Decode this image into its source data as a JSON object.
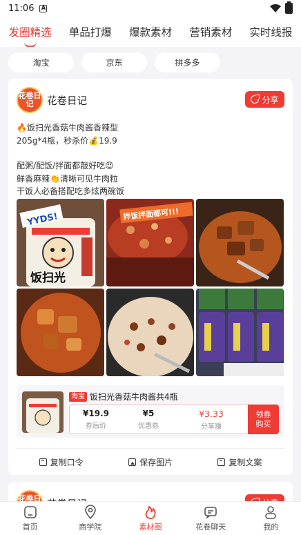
{
  "status_bar": {
    "time": "11:06",
    "sim_label": "A"
  },
  "top_tabs": [
    {
      "label": "发圈精选",
      "active": true
    },
    {
      "label": "单品打爆",
      "active": false
    },
    {
      "label": "爆款素材",
      "active": false
    },
    {
      "label": "营销素材",
      "active": false
    },
    {
      "label": "实时线报",
      "active": false
    }
  ],
  "platforms": [
    "淘宝",
    "京东",
    "拼多多"
  ],
  "post": {
    "logo_text": "花卷日记",
    "author": "花卷日记",
    "share_label": "分享",
    "lines": [
      "🔥饭扫光香菇牛肉酱香辣型",
      "205g*4瓶，秒杀价💰19.9",
      "",
      "配粥/配饭/拌面都敲好吃😍",
      "鲜香麻辣👏清晰可见牛肉粒",
      "干饭人必备搭配吃多炫两碗饭"
    ],
    "image_texts": {
      "sticker": "YYDS!",
      "banner": "拌饭拌面都可!!!",
      "jar_label": "饭扫光"
    },
    "product": {
      "platform_tag": "淘宝",
      "title": "饭扫光香菇牛肉酱共4瓶",
      "price": "¥19.9",
      "price_label": "券后价",
      "coupon": "¥5",
      "coupon_label": "优惠券",
      "commission": "¥3.33",
      "commission_label": "分享赚",
      "buy_label": "领券\n购买"
    },
    "actions": [
      {
        "label": "复制口令",
        "icon": "copy-icon"
      },
      {
        "label": "保存图片",
        "icon": "image-icon"
      },
      {
        "label": "复制文案",
        "icon": "copy-text-icon"
      }
    ]
  },
  "next_post": {
    "author": "花卷日记",
    "share_label": "分享",
    "logo_text": "花卷日记"
  },
  "bottom_nav": [
    {
      "label": "首页",
      "icon": "home-icon",
      "active": false
    },
    {
      "label": "商学院",
      "icon": "location-icon",
      "active": false
    },
    {
      "label": "素材圈",
      "icon": "flame-icon",
      "active": true
    },
    {
      "label": "花卷聊天",
      "icon": "chat-icon",
      "active": false
    },
    {
      "label": "我的",
      "icon": "user-icon",
      "active": false
    }
  ],
  "colors": {
    "accent": "#ee3b34",
    "background": "#f4f4f6",
    "logo": "#e9542a"
  }
}
